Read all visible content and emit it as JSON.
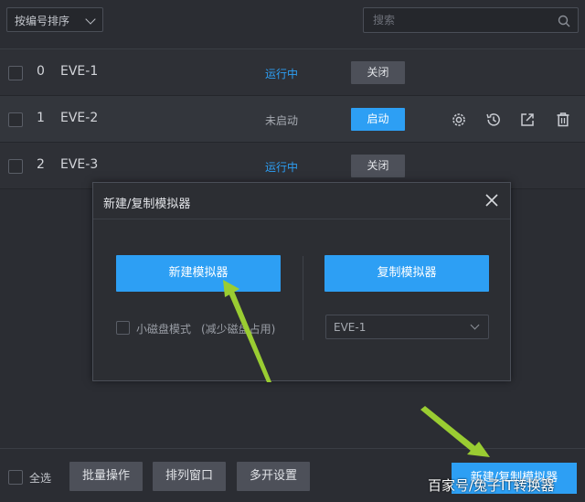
{
  "toolbar": {
    "sort_label": "按编号排序",
    "search_placeholder": "搜索"
  },
  "instances": [
    {
      "index": "0",
      "name": "EVE-1",
      "status": "运行中",
      "action": "关闭"
    },
    {
      "index": "1",
      "name": "EVE-2",
      "status": "未启动",
      "action": "启动"
    },
    {
      "index": "2",
      "name": "EVE-3",
      "status": "运行中",
      "action": "关闭"
    }
  ],
  "dialog": {
    "title": "新建/复制模拟器",
    "new_button": "新建模拟器",
    "copy_button": "复制模拟器",
    "small_disk_label": "小磁盘模式",
    "small_disk_note": "(减少磁盘占用)",
    "copy_source": "EVE-1"
  },
  "footer": {
    "select_all": "全选",
    "batch": "批量操作",
    "arrange": "排列窗口",
    "multi_settings": "多开设置",
    "new_copy": "新建/复制模拟器"
  },
  "watermark": "百家号/兔子IT转换器",
  "colors": {
    "accent": "#2d9ff4",
    "background": "#2b2d33",
    "arrow": "#9acd32"
  }
}
